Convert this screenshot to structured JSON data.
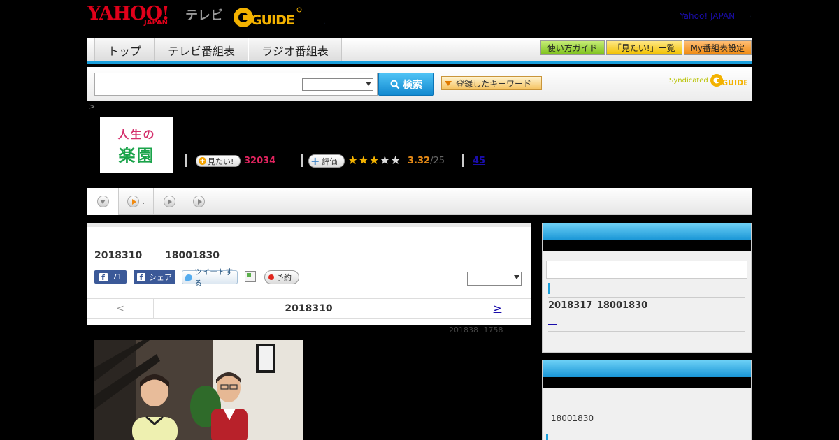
{
  "header": {
    "yahoo_logo": "YAHOO!",
    "yahoo_japan": "JAPAN",
    "tv_label": "テレビ",
    "gguide_logo": "G GUIDE",
    "dot": ".",
    "yahoo_japan_link": "Yahoo! JAPAN",
    "dot2": "."
  },
  "nav": {
    "tabs": [
      {
        "label": "トップ"
      },
      {
        "label": "テレビ番組表"
      },
      {
        "label": "ラジオ番組表"
      }
    ],
    "right_buttons": [
      {
        "label": "使い方ガイド"
      },
      {
        "label": "「見たい!」一覧"
      },
      {
        "label": "My番組表設定"
      }
    ]
  },
  "search": {
    "input_value": "",
    "select_value": "",
    "button_label": "検索",
    "keyword_button": "登録したキーワード",
    "syndicated": "Syndicated"
  },
  "breadcrumb": ">",
  "program": {
    "thumb_line1": "人生の",
    "thumb_line2": "楽園",
    "mitai_label": "見たい!",
    "mitai_count": "32034",
    "hyoka_label": "評価",
    "stars_filled": 3,
    "stars_total": 5,
    "rating_value": "3.32",
    "rating_max": "/25",
    "review_count": "45"
  },
  "tabs": [
    {
      "label": ""
    },
    {
      "label": "."
    },
    {
      "label": ""
    },
    {
      "label": ""
    }
  ],
  "episode": {
    "date_title": "2018310 18001830",
    "fb_count": "71",
    "fb_share": "シェア",
    "tweet": "ツイートする",
    "yoyaku": "予約",
    "select_value": "",
    "pager_prev": "<",
    "pager_current": "2018310",
    "pager_next": ">",
    "updated": "201838 1758"
  },
  "sidebar": {
    "next_date": "2018317 18001830",
    "dash_link": "—",
    "time_text": "18001830"
  },
  "colors": {
    "accent_blue": "#1a9fdc",
    "rating_pink": "#e2245f",
    "star_gold": "#f3b200"
  }
}
